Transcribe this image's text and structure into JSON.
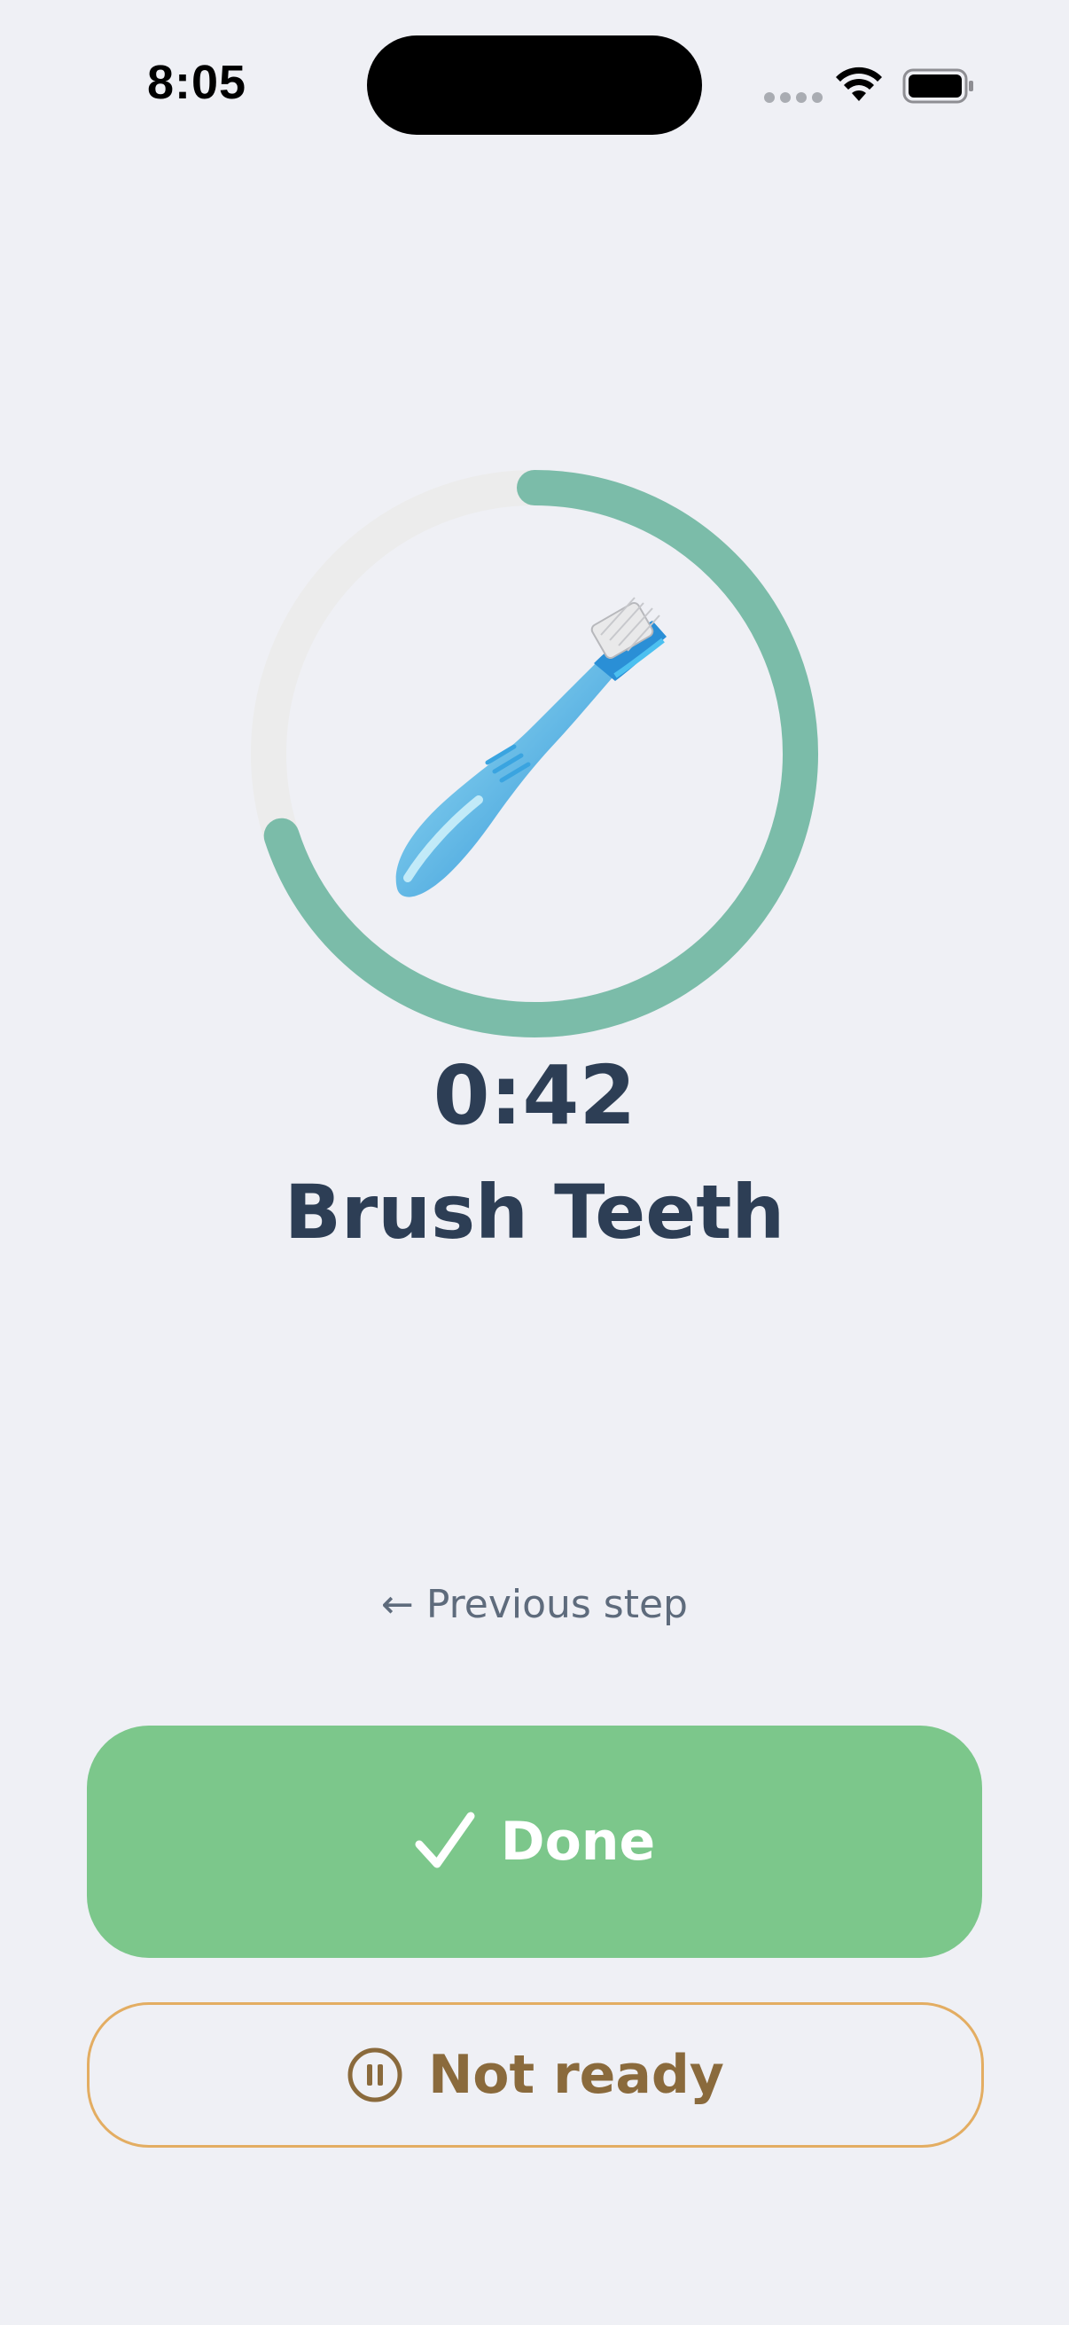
{
  "status_bar": {
    "time": "8:05"
  },
  "routine_step": {
    "timer": "0:42",
    "title": "Brush Teeth",
    "icon": "toothbrush-icon",
    "progress_fraction": 0.7
  },
  "navigation": {
    "previous_arrow": "←",
    "previous_label": "Previous step"
  },
  "actions": {
    "done_label": "Done",
    "not_ready_label": "Not ready"
  },
  "colors": {
    "background": "#eff0f5",
    "ring_progress": "#7bbca9",
    "ring_track": "#ececec",
    "done_button": "#7cc78b",
    "not_ready_border": "#e3ad62",
    "not_ready_text": "#8a6a3c",
    "title_text": "#2d3e55"
  }
}
